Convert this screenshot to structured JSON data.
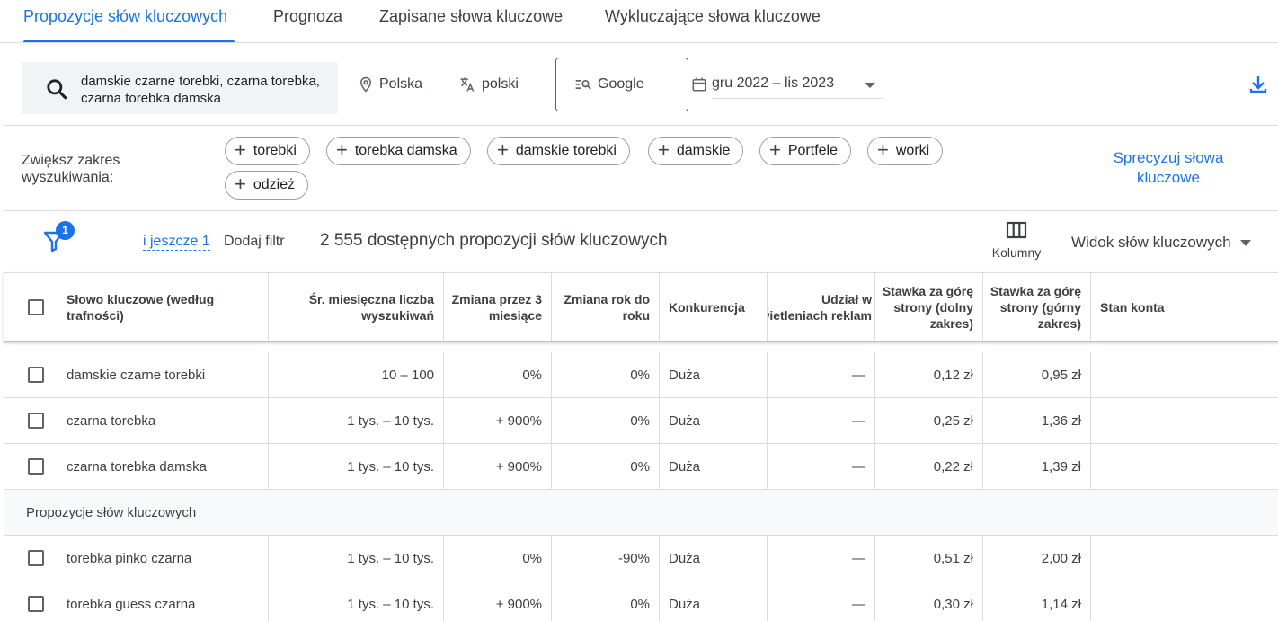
{
  "tabs": [
    {
      "label": "Propozycje słów kluczowych",
      "active": true
    },
    {
      "label": "Prognoza",
      "active": false
    },
    {
      "label": "Zapisane słowa kluczowe",
      "active": false
    },
    {
      "label": "Wykluczające słowa kluczowe",
      "active": false
    }
  ],
  "search": {
    "query": "damskie czarne torebki, czarna torebka, czarna torebka damska",
    "location": "Polska",
    "language": "polski",
    "network": "Google",
    "date_range": "gru 2022 – lis 2023"
  },
  "broaden": {
    "label": "Zwiększ zakres wyszukiwania:",
    "chips": [
      "torebki",
      "torebka damska",
      "damskie torebki",
      "damskie",
      "Portfele",
      "worki",
      "odzież"
    ],
    "refine_label": "Sprecyzuj słowa kluczowe"
  },
  "filters": {
    "badge_count": "1",
    "more_label": "i jeszcze 1",
    "add_filter_label": "Dodaj filtr",
    "results_count": "2 555 dostępnych propozycji słów kluczowych",
    "columns_label": "Kolumny",
    "view_label": "Widok słów kluczowych"
  },
  "table": {
    "headers": {
      "keyword": "Słowo kluczowe (według trafności)",
      "avg_searches": "Śr. miesięczna liczba wyszukiwań",
      "change_3m": "Zmiana przez 3 miesiące",
      "change_yoy": "Zmiana rok do roku",
      "competition": "Konkurencja",
      "impression_share": "Udział w wyświetleniach reklam",
      "bid_low": "Stawka za górę strony (dolny zakres)",
      "bid_high": "Stawka za górę strony (górny zakres)",
      "account_status": "Stan konta"
    },
    "provided_rows": [
      {
        "keyword": "damskie czarne torebki",
        "avg_searches": "10 – 100",
        "change_3m": "0%",
        "change_yoy": "0%",
        "competition": "Duża",
        "impression_share": "—",
        "bid_low": "0,12 zł",
        "bid_high": "0,95 zł"
      },
      {
        "keyword": "czarna torebka",
        "avg_searches": "1 tys. – 10 tys.",
        "change_3m": "+ 900%",
        "change_yoy": "0%",
        "competition": "Duża",
        "impression_share": "—",
        "bid_low": "0,25 zł",
        "bid_high": "1,36 zł"
      },
      {
        "keyword": "czarna torebka damska",
        "avg_searches": "1 tys. – 10 tys.",
        "change_3m": "+ 900%",
        "change_yoy": "0%",
        "competition": "Duża",
        "impression_share": "—",
        "bid_low": "0,22 zł",
        "bid_high": "1,39 zł"
      }
    ],
    "section_label": "Propozycje słów kluczowych",
    "idea_rows": [
      {
        "keyword": "torebka pinko czarna",
        "avg_searches": "1 tys. – 10 tys.",
        "change_3m": "0%",
        "change_yoy": "-90%",
        "competition": "Duża",
        "impression_share": "—",
        "bid_low": "0,51 zł",
        "bid_high": "2,00 zł"
      },
      {
        "keyword": "torebka guess czarna",
        "avg_searches": "1 tys. – 10 tys.",
        "change_3m": "+ 900%",
        "change_yoy": "0%",
        "competition": "Duża",
        "impression_share": "—",
        "bid_low": "0,30 zł",
        "bid_high": "1,14 zł"
      }
    ]
  },
  "colors": {
    "accent": "#1a73e8",
    "text": "#3c4043",
    "border": "#dadce0"
  }
}
